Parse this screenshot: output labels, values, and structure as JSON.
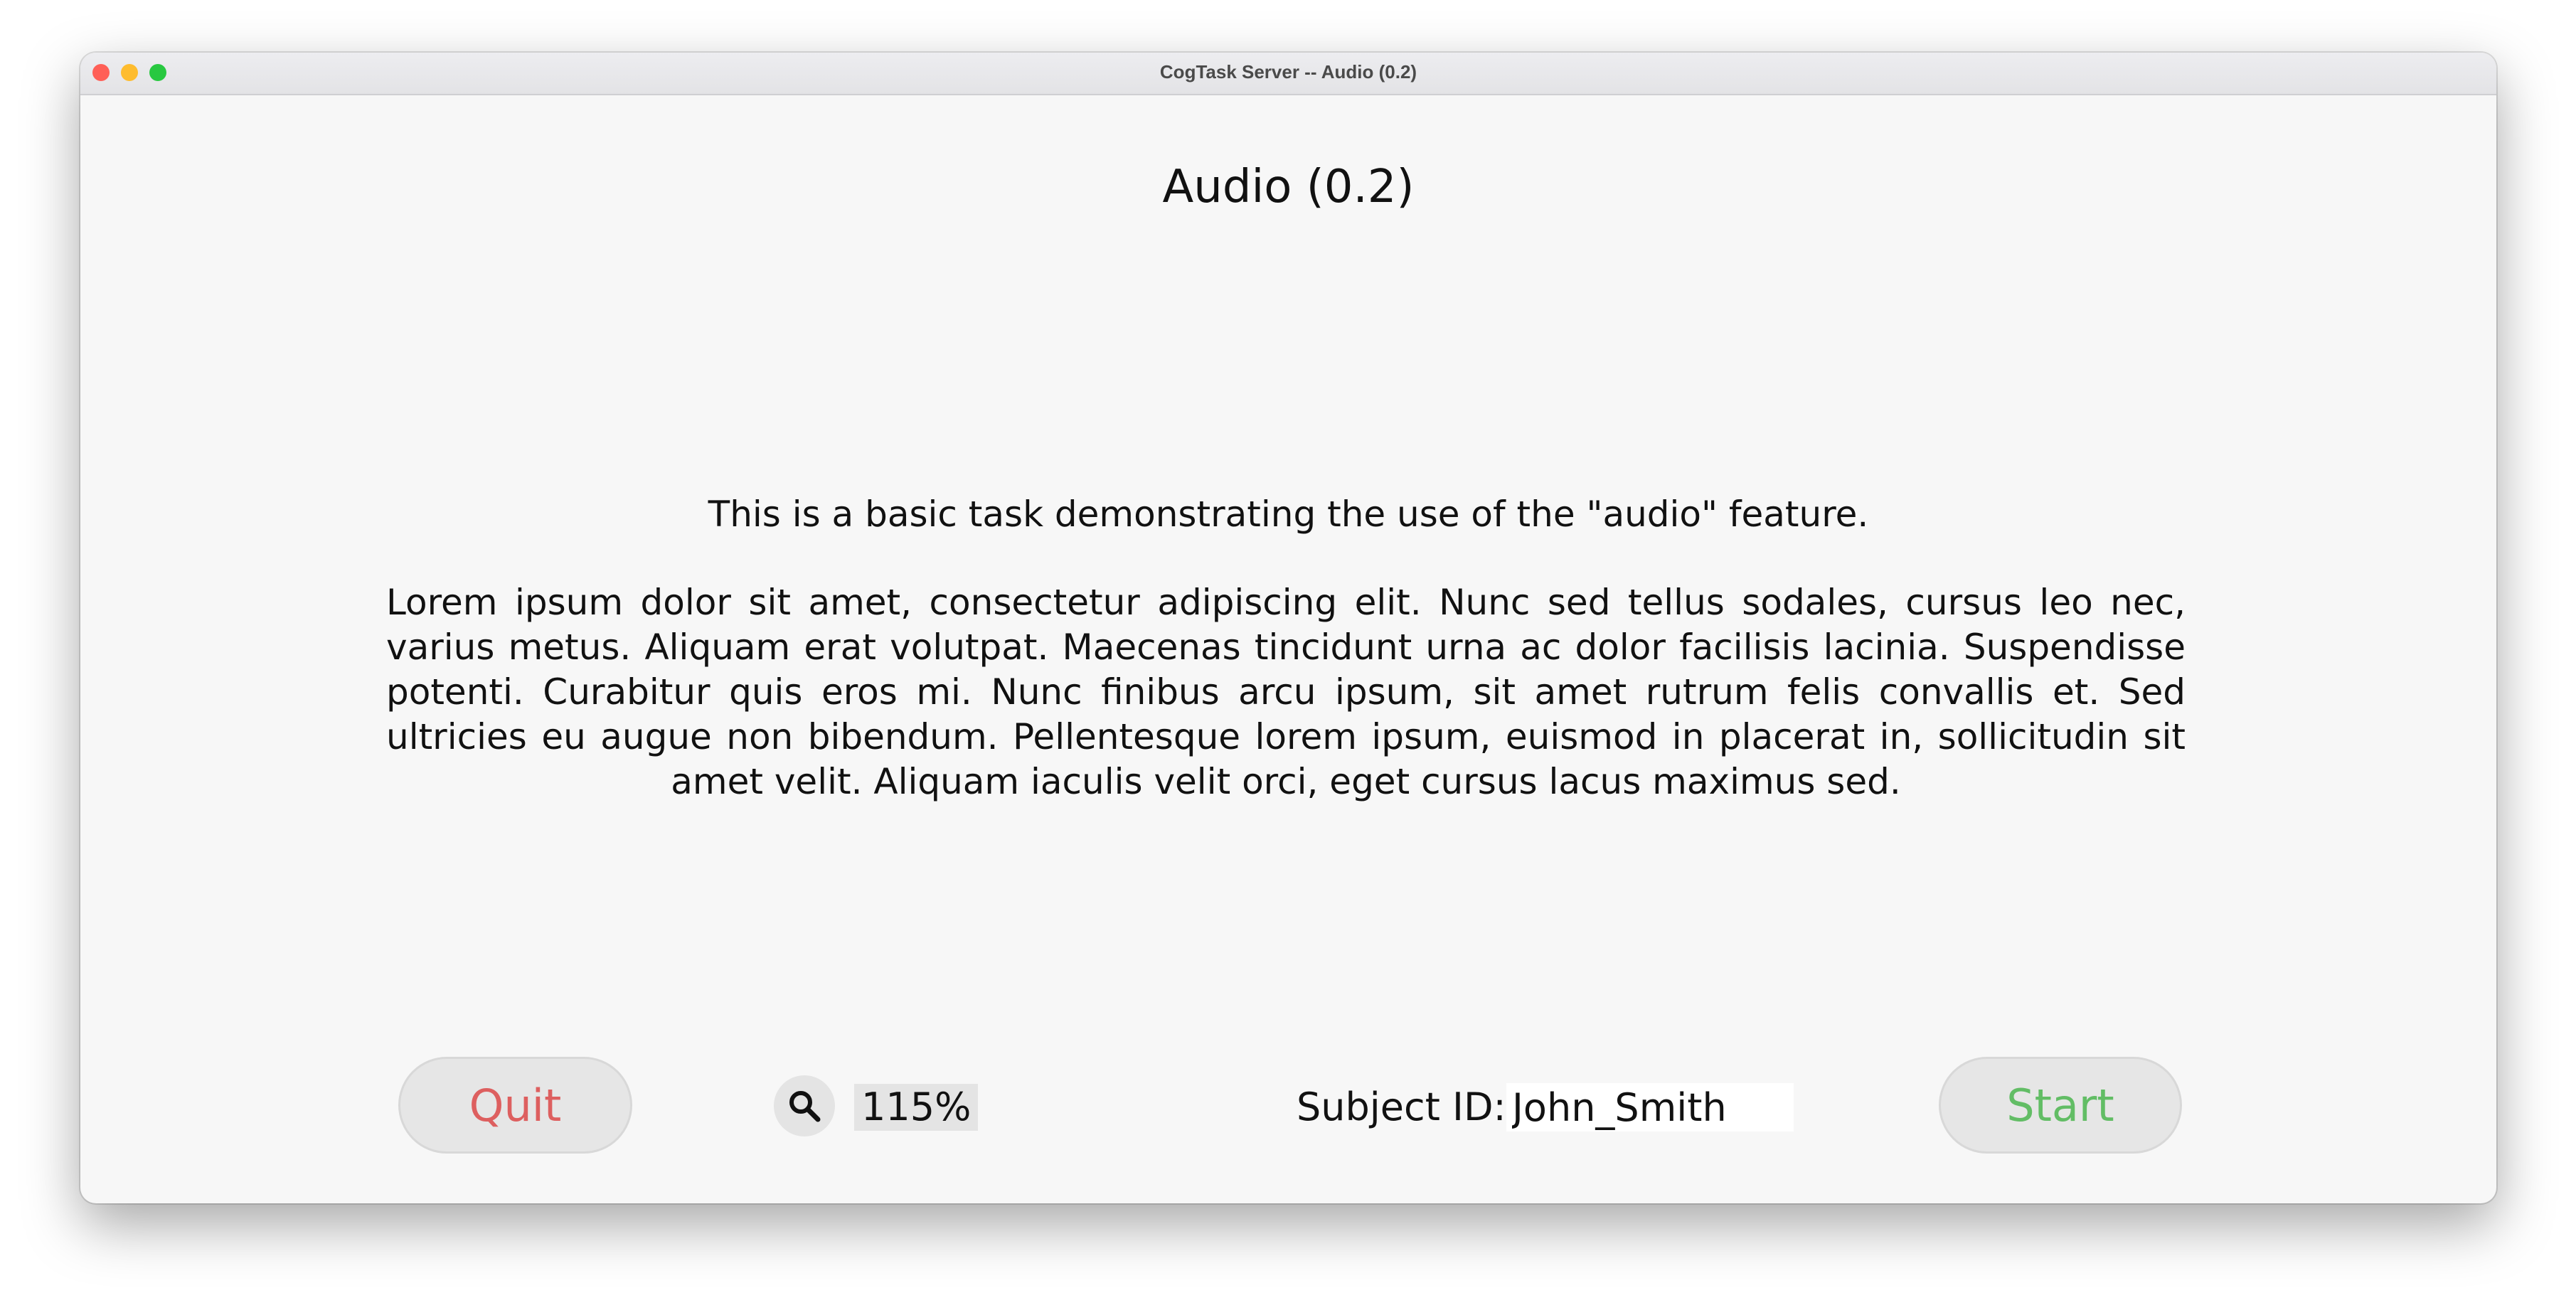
{
  "window": {
    "title": "CogTask Server -- Audio (0.2)"
  },
  "page": {
    "title": "Audio (0.2)",
    "intro": "This is a basic task demonstrating the use of the \"audio\" feature.",
    "body": "Lorem ipsum dolor sit amet, consectetur adipiscing elit. Nunc sed tellus sodales, cursus leo nec, varius metus. Aliquam erat volutpat. Maecenas tincidunt urna ac dolor facilisis lacinia. Suspendisse potenti. Curabitur quis eros mi. Nunc finibus arcu ipsum, sit amet rutrum felis convallis et. Sed ultricies eu augue non bibendum. Pellentesque lorem ipsum, euismod in placerat in, sollicitudin sit amet velit. Aliquam iaculis velit orci, eget cursus lacus maximus sed."
  },
  "controls": {
    "quit_label": "Quit",
    "zoom_icon": "magnifier-icon",
    "zoom_value": "115%",
    "subject_label": "Subject ID:",
    "subject_value": "John_Smith",
    "start_label": "Start"
  },
  "colors": {
    "quit_text": "#dd5f5f",
    "start_text": "#62bd65",
    "background": "#f7f7f7",
    "button_bg": "#e6e6e6"
  }
}
